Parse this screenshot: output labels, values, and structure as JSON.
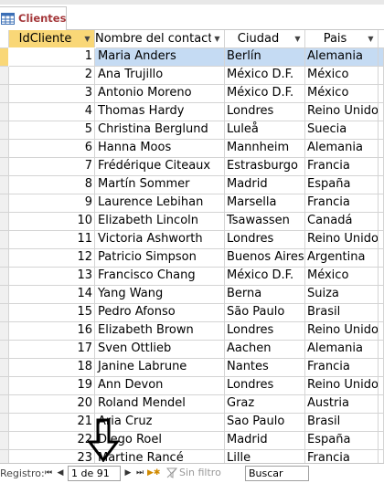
{
  "tab": {
    "label": "Clientes",
    "icon": "table-icon"
  },
  "columns": [
    {
      "label": "IdCliente",
      "key": "id"
    },
    {
      "label": "Nombre del contact",
      "key": "nm"
    },
    {
      "label": "Ciudad",
      "key": "ci"
    },
    {
      "label": "Pais",
      "key": "pa"
    }
  ],
  "rows": [
    {
      "id": "1",
      "nm": "Maria Anders",
      "ci": "Berlín",
      "pa": "Alemania"
    },
    {
      "id": "2",
      "nm": "Ana Trujillo",
      "ci": "México D.F.",
      "pa": "México"
    },
    {
      "id": "3",
      "nm": "Antonio Moreno",
      "ci": "México D.F.",
      "pa": "México"
    },
    {
      "id": "4",
      "nm": "Thomas Hardy",
      "ci": "Londres",
      "pa": "Reino Unido"
    },
    {
      "id": "5",
      "nm": "Christina Berglund",
      "ci": "Luleå",
      "pa": "Suecia"
    },
    {
      "id": "6",
      "nm": "Hanna Moos",
      "ci": "Mannheim",
      "pa": "Alemania"
    },
    {
      "id": "7",
      "nm": "Frédérique Citeaux",
      "ci": "Estrasburgo",
      "pa": "Francia"
    },
    {
      "id": "8",
      "nm": "Martín Sommer",
      "ci": "Madrid",
      "pa": "España"
    },
    {
      "id": "9",
      "nm": "Laurence Lebihan",
      "ci": "Marsella",
      "pa": "Francia"
    },
    {
      "id": "10",
      "nm": "Elizabeth Lincoln",
      "ci": "Tsawassen",
      "pa": "Canadá"
    },
    {
      "id": "11",
      "nm": "Victoria Ashworth",
      "ci": "Londres",
      "pa": "Reino Unido"
    },
    {
      "id": "12",
      "nm": "Patricio Simpson",
      "ci": "Buenos Aires",
      "pa": "Argentina"
    },
    {
      "id": "13",
      "nm": "Francisco Chang",
      "ci": "México D.F.",
      "pa": "México"
    },
    {
      "id": "14",
      "nm": "Yang Wang",
      "ci": "Berna",
      "pa": "Suiza"
    },
    {
      "id": "15",
      "nm": "Pedro Afonso",
      "ci": "São Paulo",
      "pa": "Brasil"
    },
    {
      "id": "16",
      "nm": "Elizabeth Brown",
      "ci": "Londres",
      "pa": "Reino Unido"
    },
    {
      "id": "17",
      "nm": "Sven Ottlieb",
      "ci": "Aachen",
      "pa": "Alemania"
    },
    {
      "id": "18",
      "nm": "Janine Labrune",
      "ci": "Nantes",
      "pa": "Francia"
    },
    {
      "id": "19",
      "nm": "Ann Devon",
      "ci": "Londres",
      "pa": "Reino Unido"
    },
    {
      "id": "20",
      "nm": "Roland Mendel",
      "ci": "Graz",
      "pa": "Austria"
    },
    {
      "id": "21",
      "nm": "Aria Cruz",
      "ci": "Sao Paulo",
      "pa": "Brasil"
    },
    {
      "id": "22",
      "nm": "Diego Roel",
      "ci": "Madrid",
      "pa": "España"
    },
    {
      "id": "23",
      "nm": "Martine Rancé",
      "ci": "Lille",
      "pa": "Francia"
    }
  ],
  "navbar": {
    "label": "Registro:",
    "record": "1 de 91",
    "filter": "Sin filtro",
    "search": "Buscar"
  },
  "colors": {
    "accent": "#f9d777",
    "selection": "#c5dbf3",
    "tab_text": "#a4373a"
  }
}
